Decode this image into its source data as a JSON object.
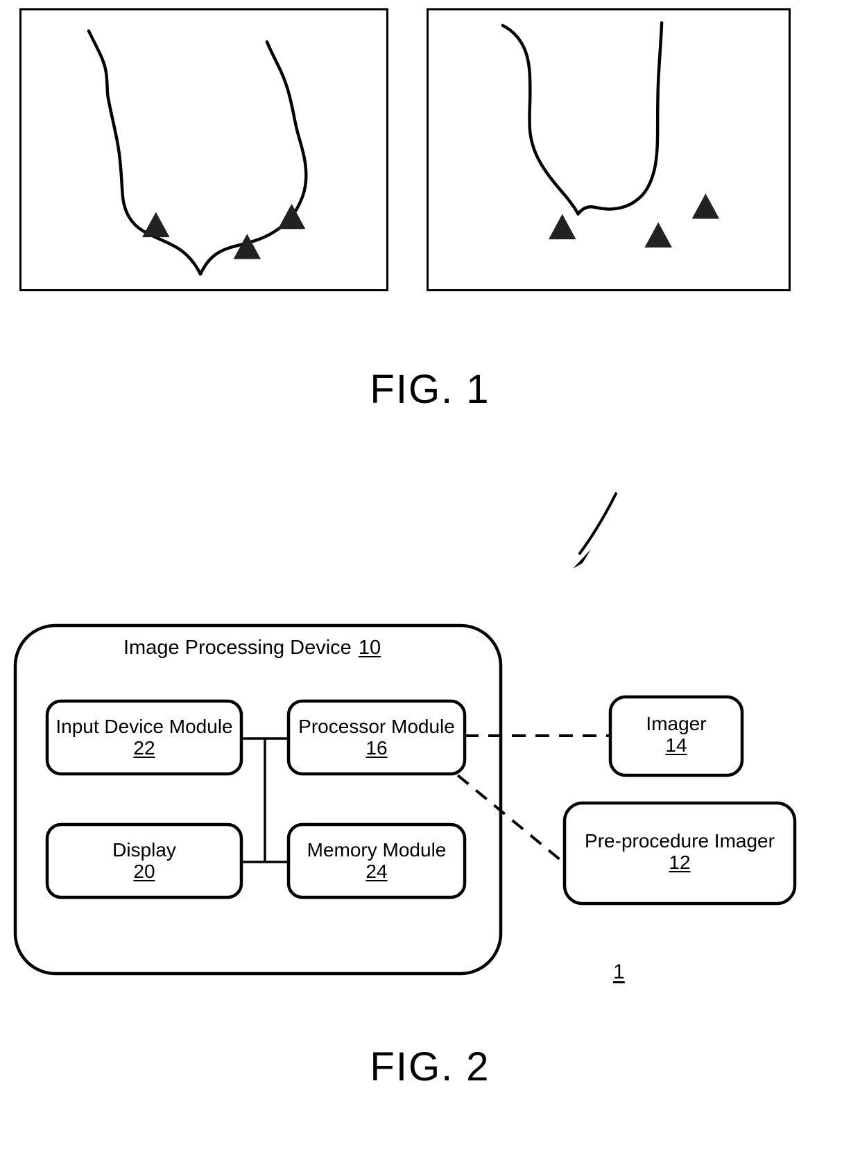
{
  "document": {
    "type": "patent-drawing-sheet",
    "ink_color": "#000000",
    "paper_color": "#ffffff"
  },
  "figure1": {
    "caption": "FIG. 1",
    "panels": [
      {
        "id": "left",
        "name": "pre-procedure-image-panel",
        "description": "outline contour of anatomical structure with 3 solid triangular landmark markers placed on the contour",
        "marker_count": 3,
        "marker_shape": "filled-triangle"
      },
      {
        "id": "right",
        "name": "intra-procedure-image-panel",
        "description": "outline contour of anatomical structure with 3 solid triangular landmark markers placed off the contour",
        "marker_count": 3,
        "marker_shape": "filled-triangle"
      }
    ]
  },
  "figure2": {
    "caption": "FIG. 2",
    "system_reference": "1",
    "container": {
      "title_text": "Image Processing Device",
      "title_number": "10"
    },
    "modules": [
      {
        "key": "input_device",
        "label": "Input Device Module",
        "number": "22"
      },
      {
        "key": "processor",
        "label": "Processor Module",
        "number": "16"
      },
      {
        "key": "display",
        "label": "Display",
        "number": "20"
      },
      {
        "key": "memory",
        "label": "Memory Module",
        "number": "24"
      }
    ],
    "external": [
      {
        "key": "imager",
        "label": "Imager",
        "number": "14"
      },
      {
        "key": "pre_procedure_imager",
        "label": "Pre-procedure Imager",
        "number": "12"
      }
    ],
    "connections": [
      {
        "from": "processor",
        "to": "imager",
        "style": "dashed"
      },
      {
        "from": "processor",
        "to": "pre_procedure_imager",
        "style": "dashed"
      },
      {
        "from": "input_device",
        "to": "processor",
        "style": "solid"
      },
      {
        "from": "display",
        "to": "memory",
        "style": "solid"
      },
      {
        "from": "input_device",
        "to": "display",
        "style": "solid"
      }
    ]
  }
}
